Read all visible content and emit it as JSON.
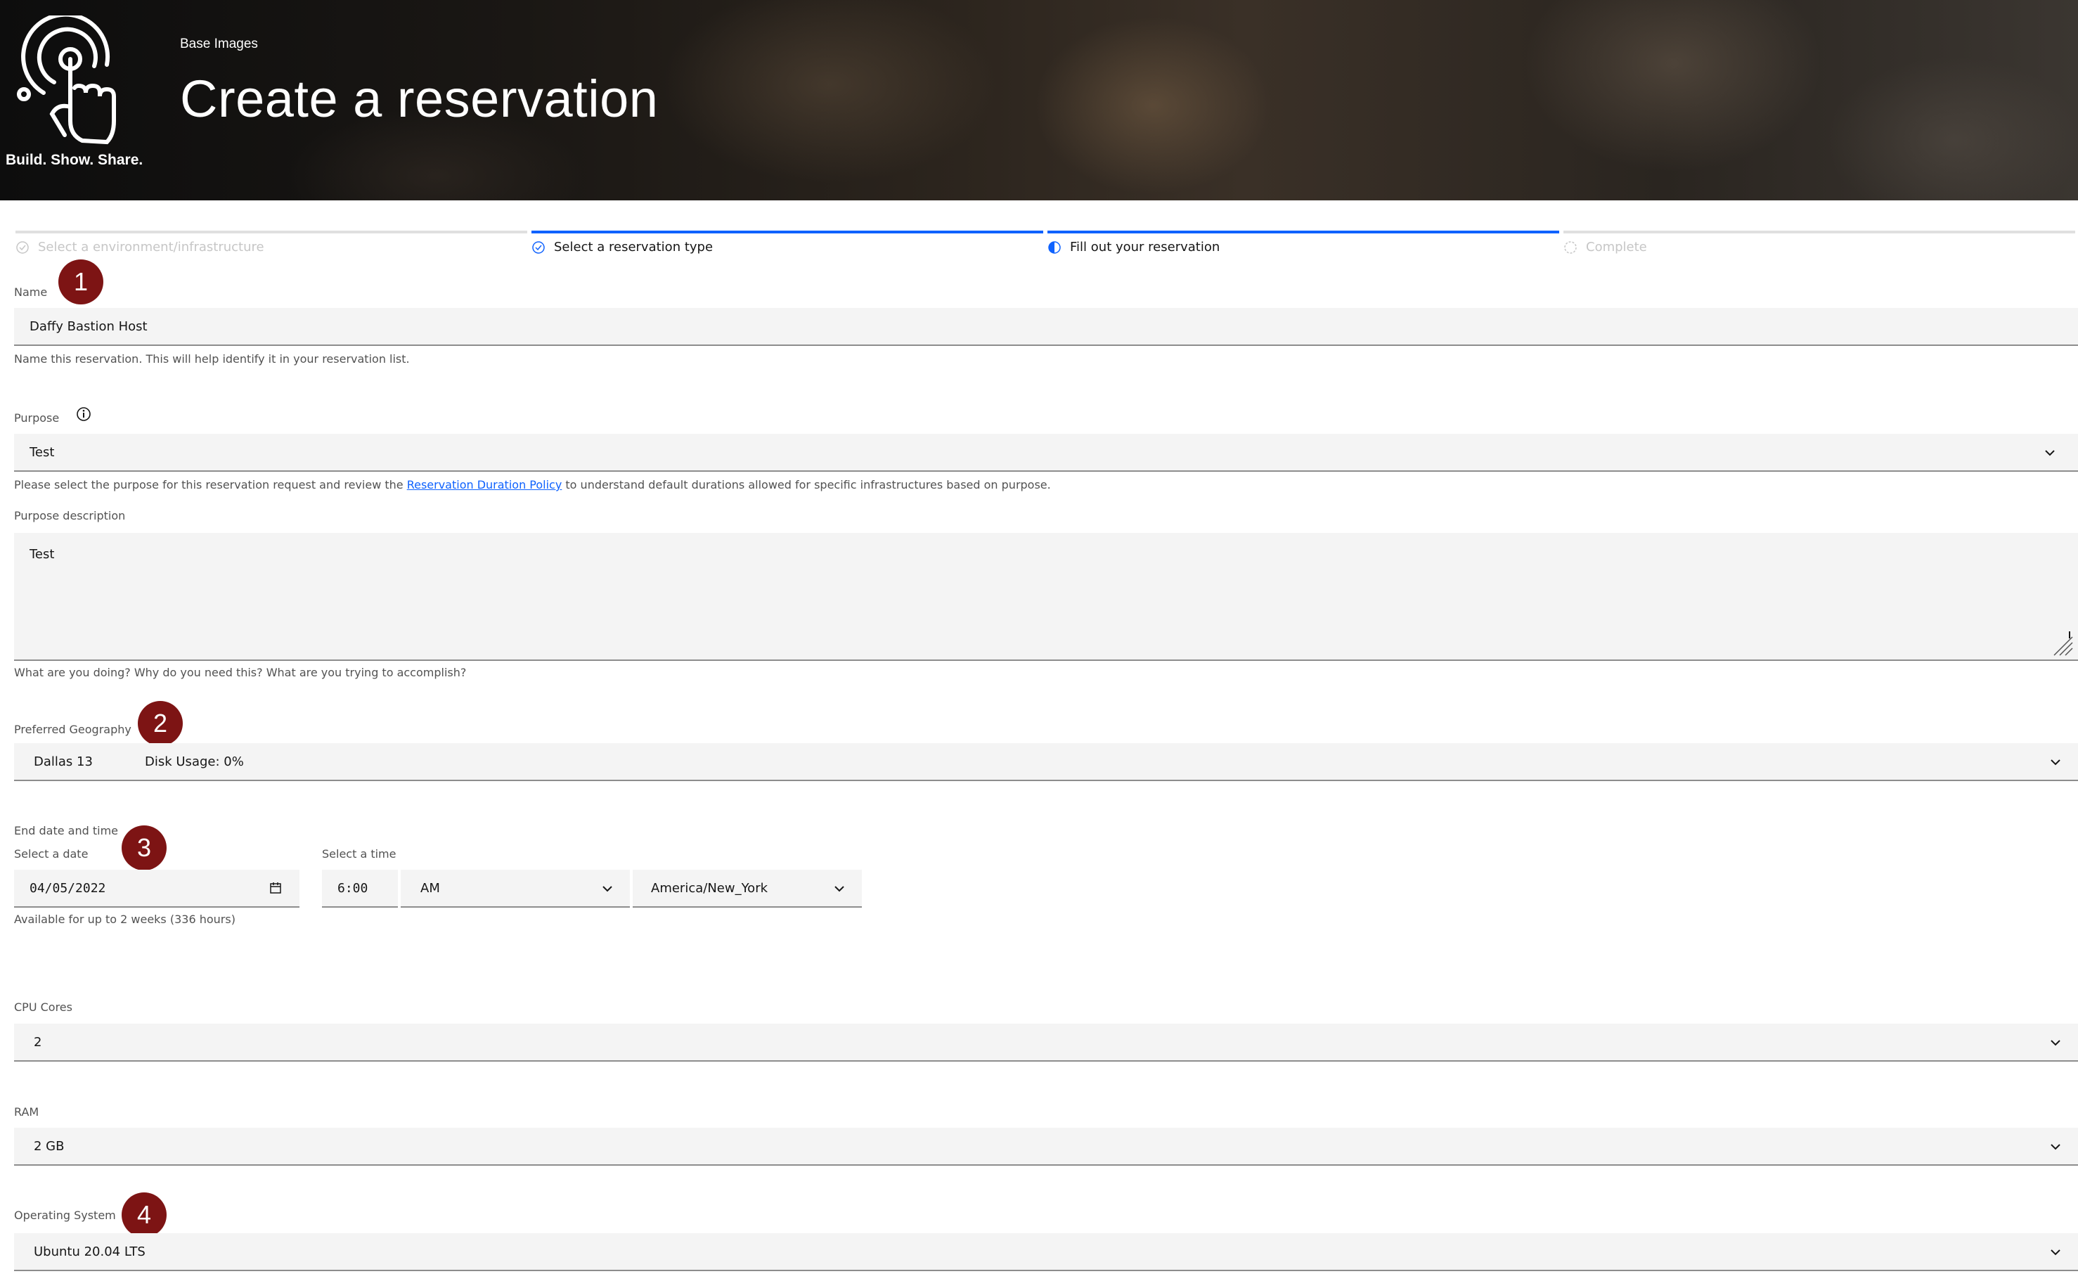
{
  "header": {
    "logo_text": "Build. Show. Share.",
    "breadcrumb": "Base Images",
    "title": "Create a reservation"
  },
  "progress": {
    "steps": [
      {
        "label": "Select a environment/infrastructure",
        "state": "disabled"
      },
      {
        "label": "Select a reservation type",
        "state": "complete"
      },
      {
        "label": "Fill out your reservation",
        "state": "current"
      },
      {
        "label": "Complete",
        "state": "incomplete"
      }
    ]
  },
  "annotations": [
    "1",
    "2",
    "3",
    "4"
  ],
  "form": {
    "name": {
      "label": "Name",
      "value": "Daffy Bastion Host",
      "helper": "Name this reservation. This will help identify it in your reservation list."
    },
    "purpose": {
      "label": "Purpose",
      "value": "Test",
      "helper_before": "Please select the purpose for this reservation request and review the ",
      "helper_link": "Reservation Duration Policy",
      "helper_after": " to understand default durations allowed for specific infrastructures based on purpose."
    },
    "purpose_description": {
      "label": "Purpose description",
      "value": "Test",
      "helper": "What are you doing? Why do you need this? What are you trying to accomplish?"
    },
    "geography": {
      "label": "Preferred Geography",
      "value": "Dallas 13",
      "disk_usage": "Disk Usage: 0%"
    },
    "end_date": {
      "label": "End date and time",
      "date_label": "Select a date",
      "date_value": "04/05/2022",
      "time_label": "Select a time",
      "time_value": "6:00",
      "ampm": "AM",
      "timezone": "America/New_York",
      "helper": "Available for up to 2 weeks (336 hours)"
    },
    "cpu": {
      "label": "CPU Cores",
      "value": "2"
    },
    "ram": {
      "label": "RAM",
      "value": "2 GB"
    },
    "os": {
      "label": "Operating System",
      "value": "Ubuntu 20.04 LTS"
    }
  },
  "colors": {
    "accent": "#0f62fe",
    "badge": "#7d1414",
    "field_bg": "#f4f4f4"
  }
}
